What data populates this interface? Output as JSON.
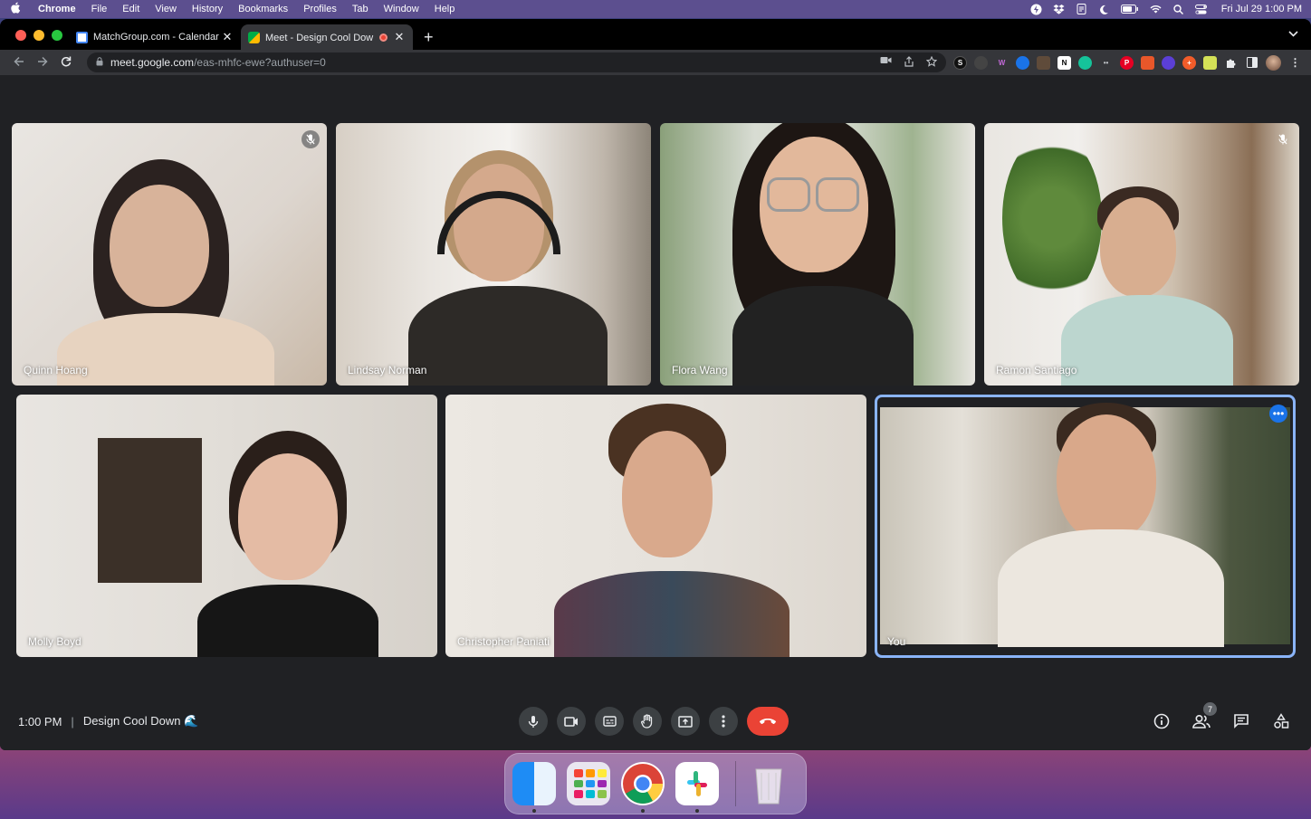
{
  "menubar": {
    "app": "Chrome",
    "items": [
      "File",
      "Edit",
      "View",
      "History",
      "Bookmarks",
      "Profiles",
      "Tab",
      "Window",
      "Help"
    ],
    "datetime": "Fri Jul 29  1:00 PM"
  },
  "browser": {
    "tabs": [
      {
        "title": "MatchGroup.com - Calendar -",
        "favicon": "calendar-icon",
        "active": false
      },
      {
        "title": "Meet - Design Cool Down 🌊",
        "favicon": "meet-icon",
        "active": true,
        "recording": true
      }
    ],
    "address": {
      "host": "meet.google.com",
      "path": "/eas-mhfc-ewe?authuser=0"
    }
  },
  "meet": {
    "participants": [
      {
        "name": "Quinn Hoang",
        "muted": true
      },
      {
        "name": "Lindsay Norman",
        "muted": false
      },
      {
        "name": "Flora Wang",
        "muted": false
      },
      {
        "name": "Ramon Santiago",
        "muted": true
      },
      {
        "name": "Molly Boyd",
        "muted": false
      },
      {
        "name": "Christopher Paniati",
        "muted": false
      },
      {
        "name": "You",
        "muted": false,
        "self": true
      }
    ],
    "time": "1:00 PM",
    "separator": "|",
    "meeting_title": "Design Cool Down 🌊",
    "people_count": "7"
  },
  "colors": {
    "meet_bg": "#202124",
    "control_bg": "#3c4043",
    "end_call": "#ea4335",
    "self_border": "#8ab4f8"
  }
}
